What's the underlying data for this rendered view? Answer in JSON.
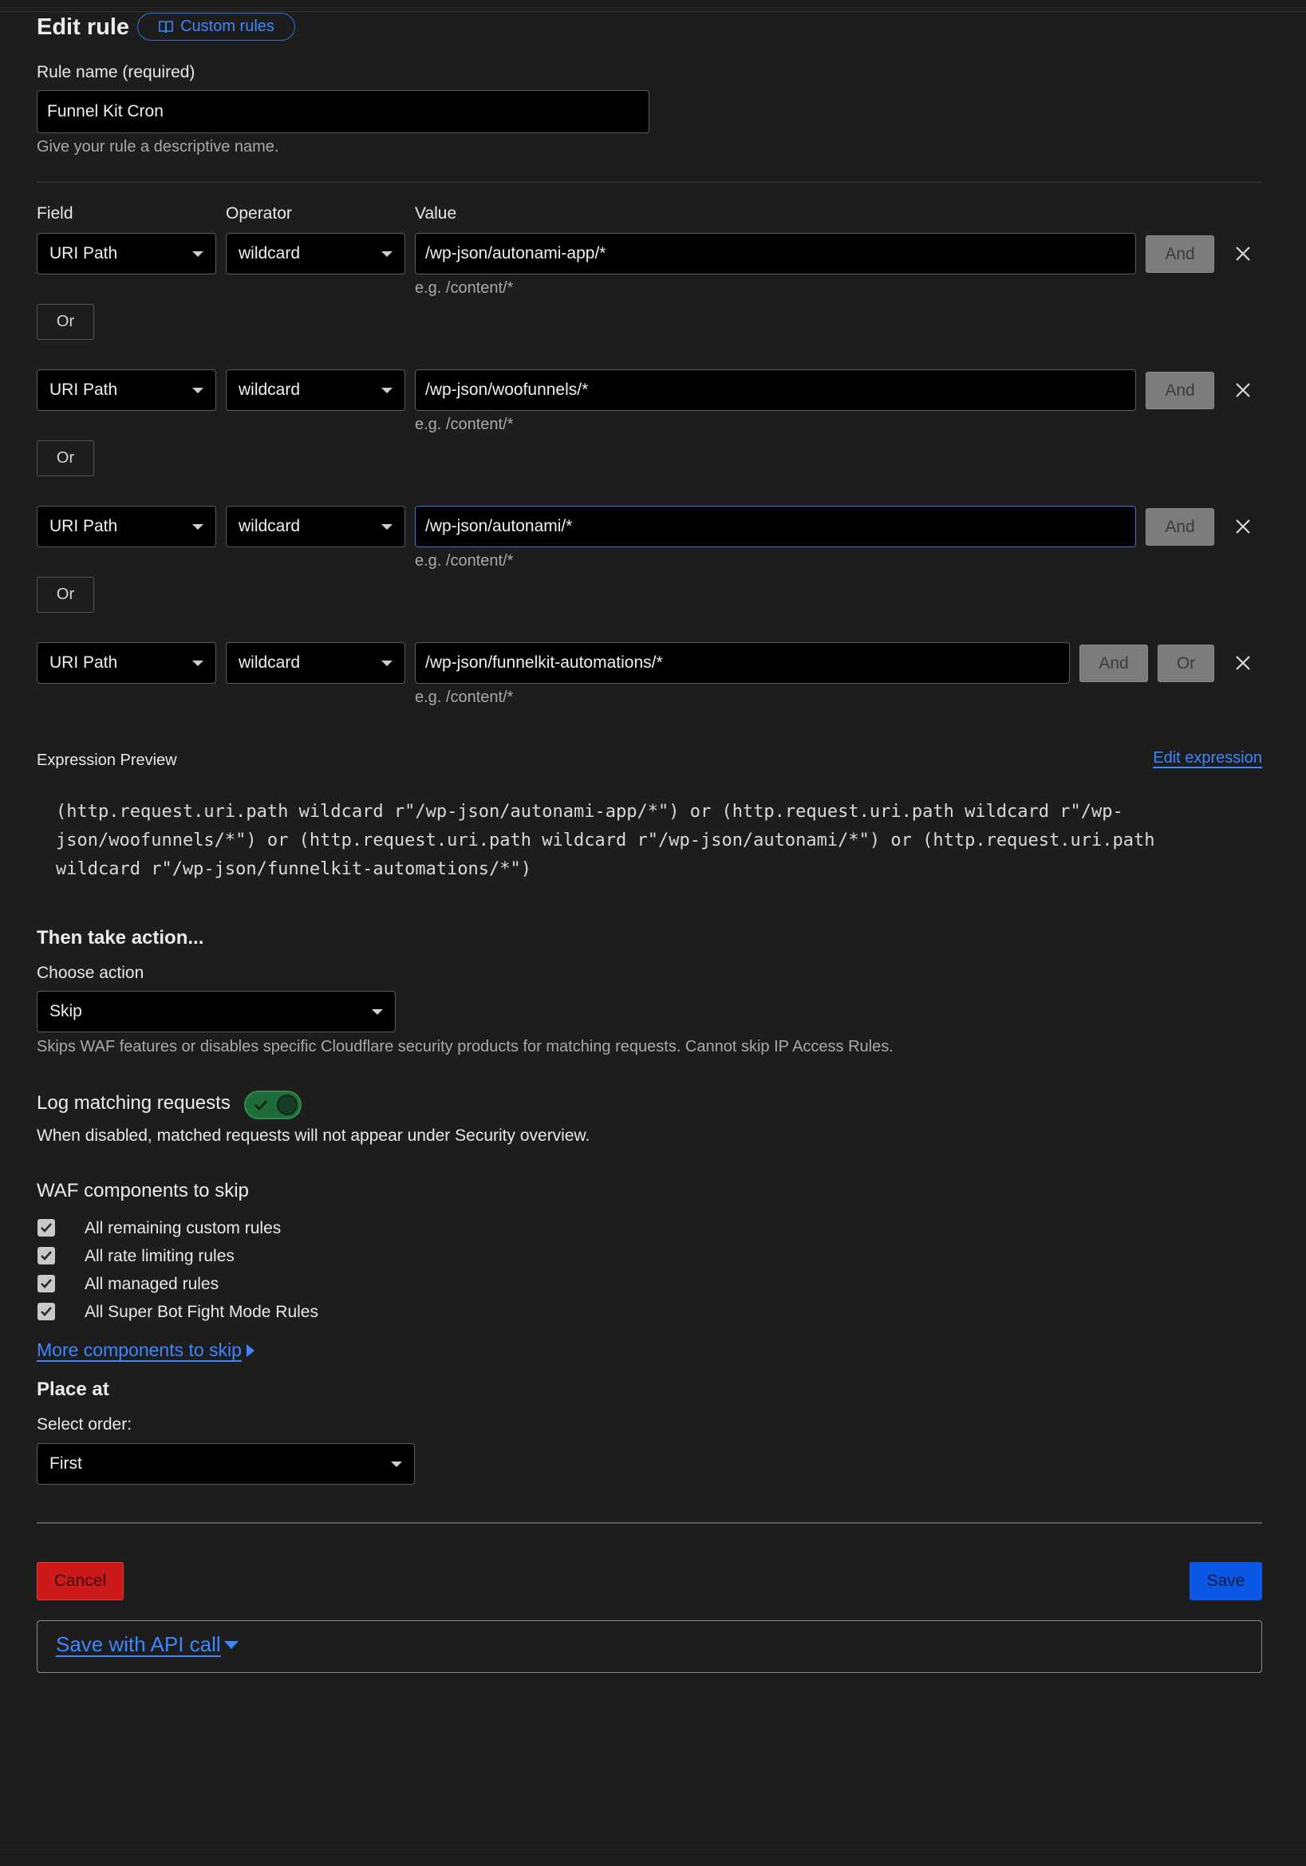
{
  "header": {
    "title": "Edit rule",
    "docs_link": "Custom rules"
  },
  "rule_name": {
    "label": "Rule name (required)",
    "value": "Funnel Kit Cron",
    "hint": "Give your rule a descriptive name."
  },
  "conditions": {
    "field_label": "Field",
    "operator_label": "Operator",
    "value_label": "Value",
    "value_hint": "e.g. /content/*",
    "and_label": "And",
    "or_label": "Or",
    "rows": [
      {
        "field": "URI Path",
        "operator": "wildcard",
        "value": "/wp-json/autonami-app/*"
      },
      {
        "field": "URI Path",
        "operator": "wildcard",
        "value": "/wp-json/woofunnels/*"
      },
      {
        "field": "URI Path",
        "operator": "wildcard",
        "value": "/wp-json/autonami/*"
      },
      {
        "field": "URI Path",
        "operator": "wildcard",
        "value": "/wp-json/funnelkit-automations/*"
      }
    ]
  },
  "expression": {
    "label": "Expression Preview",
    "edit_link": "Edit expression",
    "lines": [
      "(http.request.uri.path wildcard r\"/wp-json/autonami-app/*\") or (http.request.uri.path wildcard r\"/wp-",
      "json/woofunnels/*\") or (http.request.uri.path wildcard r\"/wp-json/autonami/*\") or (http.request.uri.path",
      "wildcard r\"/wp-json/funnelkit-automations/*\")"
    ]
  },
  "action": {
    "heading": "Then take action...",
    "label": "Choose action",
    "value": "Skip",
    "hint": "Skips WAF features or disables specific Cloudflare security products for matching requests. Cannot skip IP Access Rules."
  },
  "logging": {
    "label": "Log matching requests",
    "enabled": true,
    "hint": "When disabled, matched requests will not appear under Security overview."
  },
  "waf": {
    "heading": "WAF components to skip",
    "items": [
      {
        "label": "All remaining custom rules",
        "checked": true
      },
      {
        "label": "All rate limiting rules",
        "checked": true
      },
      {
        "label": "All managed rules",
        "checked": true
      },
      {
        "label": "All Super Bot Fight Mode Rules",
        "checked": true
      }
    ],
    "more_link": "More components to skip"
  },
  "place": {
    "heading": "Place at",
    "label": "Select order:",
    "value": "First"
  },
  "footer": {
    "cancel": "Cancel",
    "save": "Save",
    "api": "Save with API call"
  },
  "colors": {
    "background": "#1d1d1e",
    "accent": "#3d86ff",
    "danger": "#cc1a1a",
    "primary": "#0b57e6",
    "toggle_on": "#1f6b3a"
  }
}
